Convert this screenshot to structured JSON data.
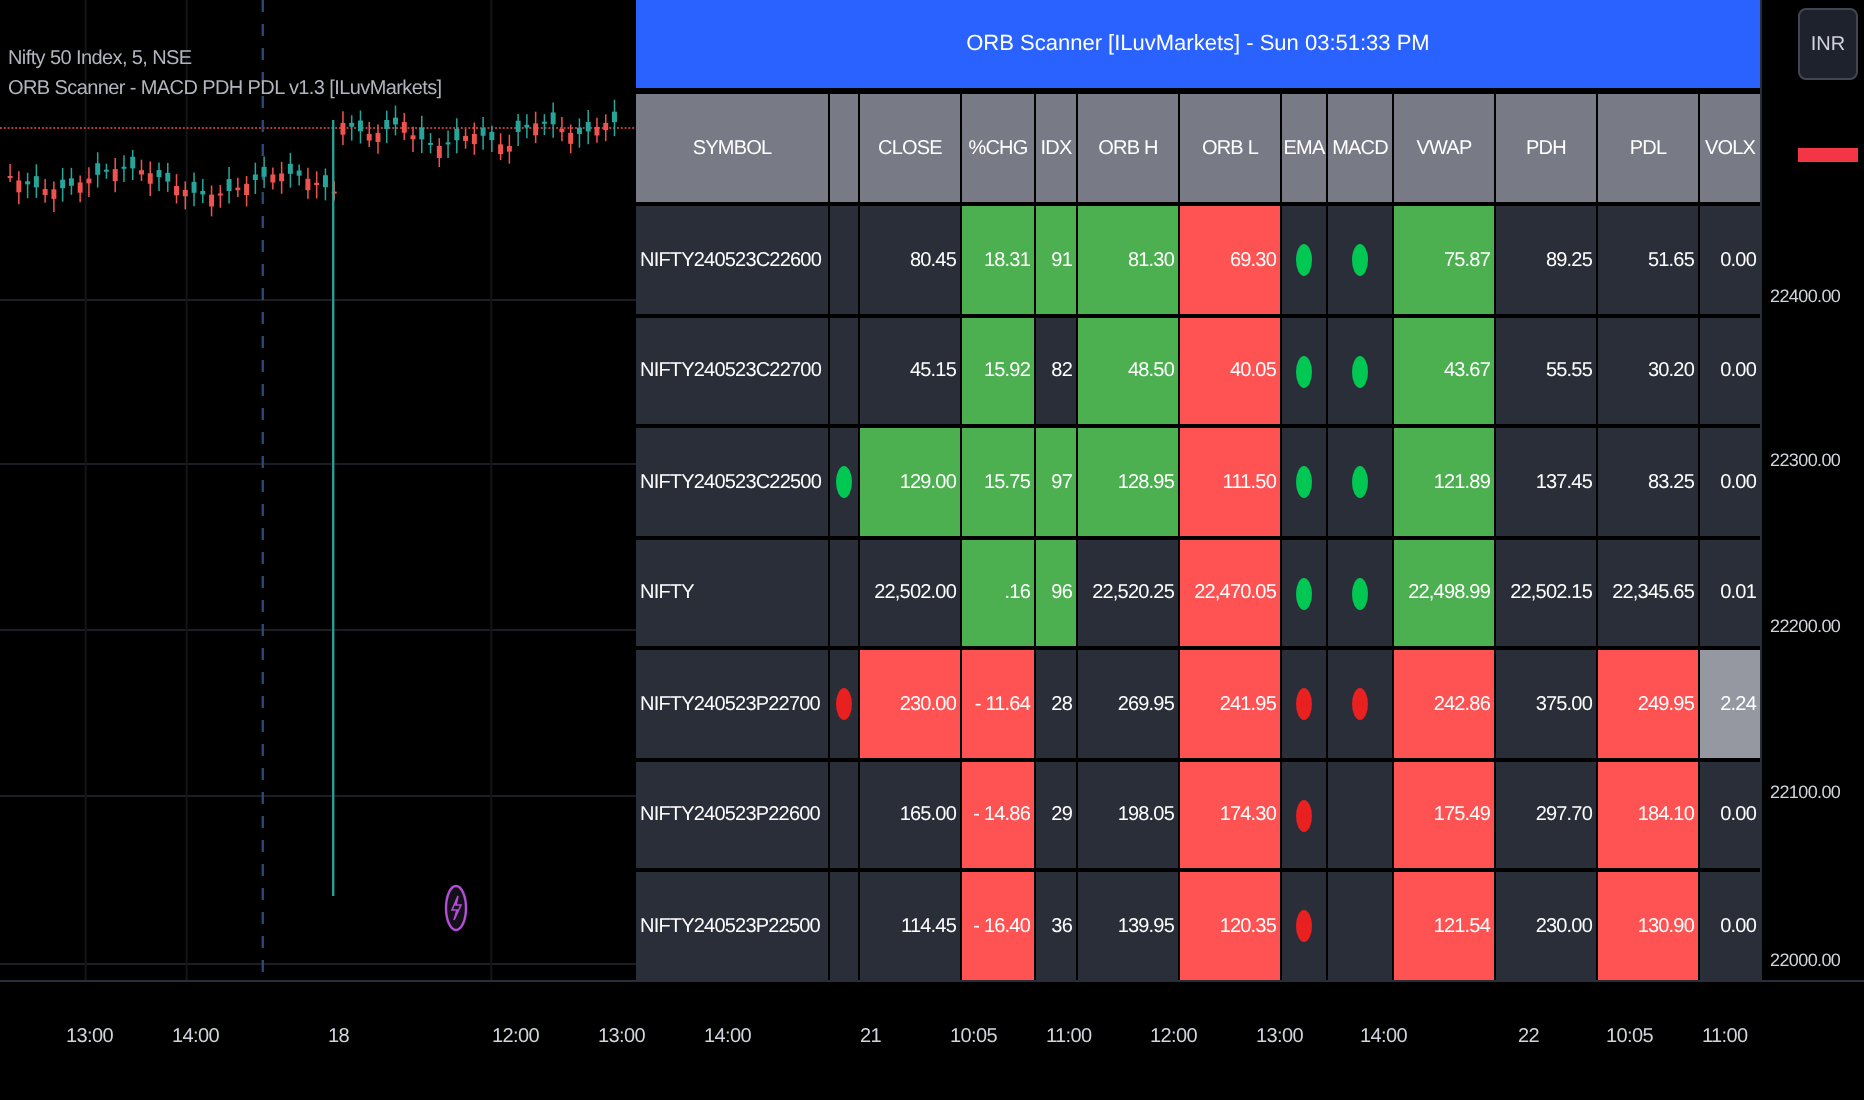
{
  "chart": {
    "symbol_label": "Nifty 50 Index, 5, NSE",
    "indicator_label": "ORB Scanner - MACD PDH PDL v1.3 [ILuvMarkets]"
  },
  "scanner": {
    "title": "ORB Scanner [ILuvMarkets] - Sun 03:51:33 PM",
    "columns": [
      {
        "kind": "text",
        "label": "SYMBOL"
      },
      {
        "kind": "blank"
      },
      {
        "kind": "text",
        "label": "CLOSE"
      },
      {
        "kind": "text",
        "label": "%CHG"
      },
      {
        "kind": "text",
        "label": "IDX"
      },
      {
        "kind": "text",
        "label": "ORB H"
      },
      {
        "kind": "text",
        "label": "ORB L"
      },
      {
        "kind": "text",
        "label": "EMA"
      },
      {
        "kind": "text",
        "label": "MACD"
      },
      {
        "kind": "text",
        "label": "VWAP"
      },
      {
        "kind": "text",
        "label": "PDH"
      },
      {
        "kind": "text",
        "label": "PDL"
      },
      {
        "kind": "text",
        "label": "VOLX"
      }
    ],
    "rows": [
      {
        "cells": [
          {
            "kind": "text",
            "text": "NIFTY240523C22600"
          },
          {
            "kind": "blank"
          },
          {
            "kind": "text",
            "text": "80.45"
          },
          {
            "kind": "text",
            "text": "18.31",
            "color": "#4caf50"
          },
          {
            "kind": "text",
            "text": "91",
            "color": "#4caf50"
          },
          {
            "kind": "text",
            "text": "81.30",
            "color": "#4caf50"
          },
          {
            "kind": "text",
            "text": "69.30",
            "color": "#ff5252"
          },
          {
            "kind": "dot",
            "color": "#00c853"
          },
          {
            "kind": "dot",
            "color": "#00c853"
          },
          {
            "kind": "text",
            "text": "75.87",
            "color": "#4caf50"
          },
          {
            "kind": "text",
            "text": "89.25"
          },
          {
            "kind": "text",
            "text": "51.65"
          },
          {
            "kind": "text",
            "text": "0.00"
          }
        ]
      },
      {
        "cells": [
          {
            "kind": "text",
            "text": "NIFTY240523C22700"
          },
          {
            "kind": "blank"
          },
          {
            "kind": "text",
            "text": "45.15"
          },
          {
            "kind": "text",
            "text": "15.92",
            "color": "#4caf50"
          },
          {
            "kind": "text",
            "text": "82"
          },
          {
            "kind": "text",
            "text": "48.50",
            "color": "#4caf50"
          },
          {
            "kind": "text",
            "text": "40.05",
            "color": "#ff5252"
          },
          {
            "kind": "dot",
            "color": "#00c853"
          },
          {
            "kind": "dot",
            "color": "#00c853"
          },
          {
            "kind": "text",
            "text": "43.67",
            "color": "#4caf50"
          },
          {
            "kind": "text",
            "text": "55.55"
          },
          {
            "kind": "text",
            "text": "30.20"
          },
          {
            "kind": "text",
            "text": "0.00"
          }
        ]
      },
      {
        "cells": [
          {
            "kind": "text",
            "text": "NIFTY240523C22500"
          },
          {
            "kind": "dot",
            "color": "#00c853"
          },
          {
            "kind": "text",
            "text": "129.00",
            "color": "#4caf50"
          },
          {
            "kind": "text",
            "text": "15.75",
            "color": "#4caf50"
          },
          {
            "kind": "text",
            "text": "97",
            "color": "#4caf50"
          },
          {
            "kind": "text",
            "text": "128.95",
            "color": "#4caf50"
          },
          {
            "kind": "text",
            "text": "111.50",
            "color": "#ff5252"
          },
          {
            "kind": "dot",
            "color": "#00c853"
          },
          {
            "kind": "dot",
            "color": "#00c853"
          },
          {
            "kind": "text",
            "text": "121.89",
            "color": "#4caf50"
          },
          {
            "kind": "text",
            "text": "137.45"
          },
          {
            "kind": "text",
            "text": "83.25"
          },
          {
            "kind": "text",
            "text": "0.00"
          }
        ]
      },
      {
        "cells": [
          {
            "kind": "text",
            "text": "NIFTY"
          },
          {
            "kind": "blank"
          },
          {
            "kind": "text",
            "text": "22,502.00"
          },
          {
            "kind": "text",
            "text": ".16",
            "color": "#4caf50"
          },
          {
            "kind": "text",
            "text": "96",
            "color": "#4caf50"
          },
          {
            "kind": "text",
            "text": "22,520.25"
          },
          {
            "kind": "text",
            "text": "22,470.05",
            "color": "#ff5252"
          },
          {
            "kind": "dot",
            "color": "#00c853"
          },
          {
            "kind": "dot",
            "color": "#00c853"
          },
          {
            "kind": "text",
            "text": "22,498.99",
            "color": "#4caf50"
          },
          {
            "kind": "text",
            "text": "22,502.15"
          },
          {
            "kind": "text",
            "text": "22,345.65"
          },
          {
            "kind": "text",
            "text": "0.01"
          }
        ]
      },
      {
        "cells": [
          {
            "kind": "text",
            "text": "NIFTY240523P22700"
          },
          {
            "kind": "dot",
            "color": "#e8201f"
          },
          {
            "kind": "text",
            "text": "230.00",
            "color": "#ff5252"
          },
          {
            "kind": "text",
            "text": "- 11.64",
            "color": "#ff5252"
          },
          {
            "kind": "text",
            "text": "28"
          },
          {
            "kind": "text",
            "text": "269.95"
          },
          {
            "kind": "text",
            "text": "241.95",
            "color": "#ff5252"
          },
          {
            "kind": "dot",
            "color": "#e8201f"
          },
          {
            "kind": "dot",
            "color": "#e8201f"
          },
          {
            "kind": "text",
            "text": "242.86",
            "color": "#ff5252"
          },
          {
            "kind": "text",
            "text": "375.00"
          },
          {
            "kind": "text",
            "text": "249.95",
            "color": "#ff5252"
          },
          {
            "kind": "text",
            "text": "2.24",
            "color": "#9598a1"
          }
        ]
      },
      {
        "cells": [
          {
            "kind": "text",
            "text": "NIFTY240523P22600"
          },
          {
            "kind": "blank"
          },
          {
            "kind": "text",
            "text": "165.00"
          },
          {
            "kind": "text",
            "text": "- 14.86",
            "color": "#ff5252"
          },
          {
            "kind": "text",
            "text": "29"
          },
          {
            "kind": "text",
            "text": "198.05"
          },
          {
            "kind": "text",
            "text": "174.30",
            "color": "#ff5252"
          },
          {
            "kind": "dot",
            "color": "#e8201f"
          },
          {
            "kind": "blank"
          },
          {
            "kind": "text",
            "text": "175.49",
            "color": "#ff5252"
          },
          {
            "kind": "text",
            "text": "297.70"
          },
          {
            "kind": "text",
            "text": "184.10",
            "color": "#ff5252"
          },
          {
            "kind": "text",
            "text": "0.00"
          }
        ]
      },
      {
        "cells": [
          {
            "kind": "text",
            "text": "NIFTY240523P22500"
          },
          {
            "kind": "blank"
          },
          {
            "kind": "text",
            "text": "114.45"
          },
          {
            "kind": "text",
            "text": "- 16.40",
            "color": "#ff5252"
          },
          {
            "kind": "text",
            "text": "36"
          },
          {
            "kind": "text",
            "text": "139.95"
          },
          {
            "kind": "text",
            "text": "120.35",
            "color": "#ff5252"
          },
          {
            "kind": "dot",
            "color": "#e8201f"
          },
          {
            "kind": "blank"
          },
          {
            "kind": "text",
            "text": "121.54",
            "color": "#ff5252"
          },
          {
            "kind": "text",
            "text": "230.00"
          },
          {
            "kind": "text",
            "text": "130.90",
            "color": "#ff5252"
          },
          {
            "kind": "text",
            "text": "0.00"
          }
        ]
      }
    ]
  },
  "price_axis": {
    "currency_button": "INR",
    "labels": [
      "22400.00",
      "22300.00",
      "22200.00",
      "22100.00",
      "22000.00"
    ]
  },
  "time_axis": {
    "labels": [
      "13:00",
      "14:00",
      "18",
      "12:00",
      "13:00",
      "14:00",
      "21",
      "10:05",
      "11:00",
      "12:00",
      "13:00",
      "14:00",
      "22",
      "10:05",
      "11:00"
    ]
  }
}
